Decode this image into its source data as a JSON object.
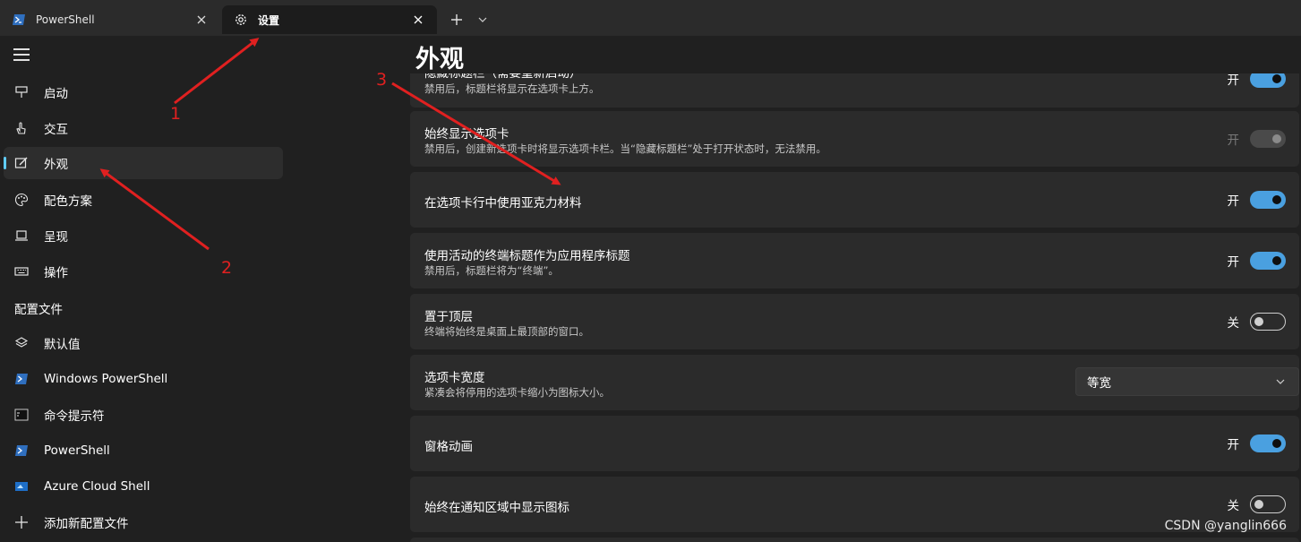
{
  "tabs": [
    {
      "label": "PowerShell",
      "icon": "powershell-icon",
      "active": false
    },
    {
      "label": "设置",
      "icon": "gear-icon",
      "active": true
    }
  ],
  "sidebar": {
    "items": [
      {
        "label": "启动",
        "icon": "startup-icon"
      },
      {
        "label": "交互",
        "icon": "touch-hand-icon"
      },
      {
        "label": "外观",
        "icon": "appearance-edit-icon",
        "selected": true
      },
      {
        "label": "配色方案",
        "icon": "palette-icon"
      },
      {
        "label": "呈现",
        "icon": "laptop-icon"
      },
      {
        "label": "操作",
        "icon": "keyboard-icon"
      }
    ],
    "profiles_header": "配置文件",
    "profiles": [
      {
        "label": "默认值",
        "icon": "layers-icon"
      },
      {
        "label": "Windows PowerShell",
        "icon": "powershell-icon"
      },
      {
        "label": "命令提示符",
        "icon": "cmd-icon"
      },
      {
        "label": "PowerShell",
        "icon": "powershell-icon"
      },
      {
        "label": "Azure Cloud Shell",
        "icon": "azure-shell-icon"
      },
      {
        "label": "添加新配置文件",
        "icon": "plus-icon"
      }
    ]
  },
  "main": {
    "title": "外观",
    "settings": [
      {
        "title": "隐藏标题栏（需要重新启动）",
        "desc": "禁用后，标题栏将显示在选项卡上方。",
        "state_text": "开",
        "state": "on"
      },
      {
        "title": "始终显示选项卡",
        "desc": "禁用后，创建新选项卡时将显示选项卡栏。当“隐藏标题栏”处于打开状态时，无法禁用。",
        "state_text": "开",
        "state": "disabled"
      },
      {
        "title": "在选项卡行中使用亚克力材料",
        "desc": "",
        "state_text": "开",
        "state": "on"
      },
      {
        "title": "使用活动的终端标题作为应用程序标题",
        "desc": "禁用后，标题栏将为“终端”。",
        "state_text": "开",
        "state": "on"
      },
      {
        "title": "置于顶层",
        "desc": "终端将始终是桌面上最顶部的窗口。",
        "state_text": "关",
        "state": "off"
      },
      {
        "title": "选项卡宽度",
        "desc": "紧凑会将停用的选项卡缩小为图标大小。",
        "dropdown_value": "等宽"
      },
      {
        "title": "窗格动画",
        "desc": "",
        "state_text": "开",
        "state": "on"
      },
      {
        "title": "始终在通知区域中显示图标",
        "desc": "",
        "state_text": "关",
        "state": "off"
      }
    ]
  },
  "annotations": [
    "1",
    "2",
    "3"
  ],
  "watermark": "CSDN @yanglin666",
  "colors": {
    "accent": "#60cdff",
    "toggle_on": "#4aa0e0",
    "annotation": "#e02020",
    "background": "#202020",
    "card": "#2b2b2b"
  }
}
